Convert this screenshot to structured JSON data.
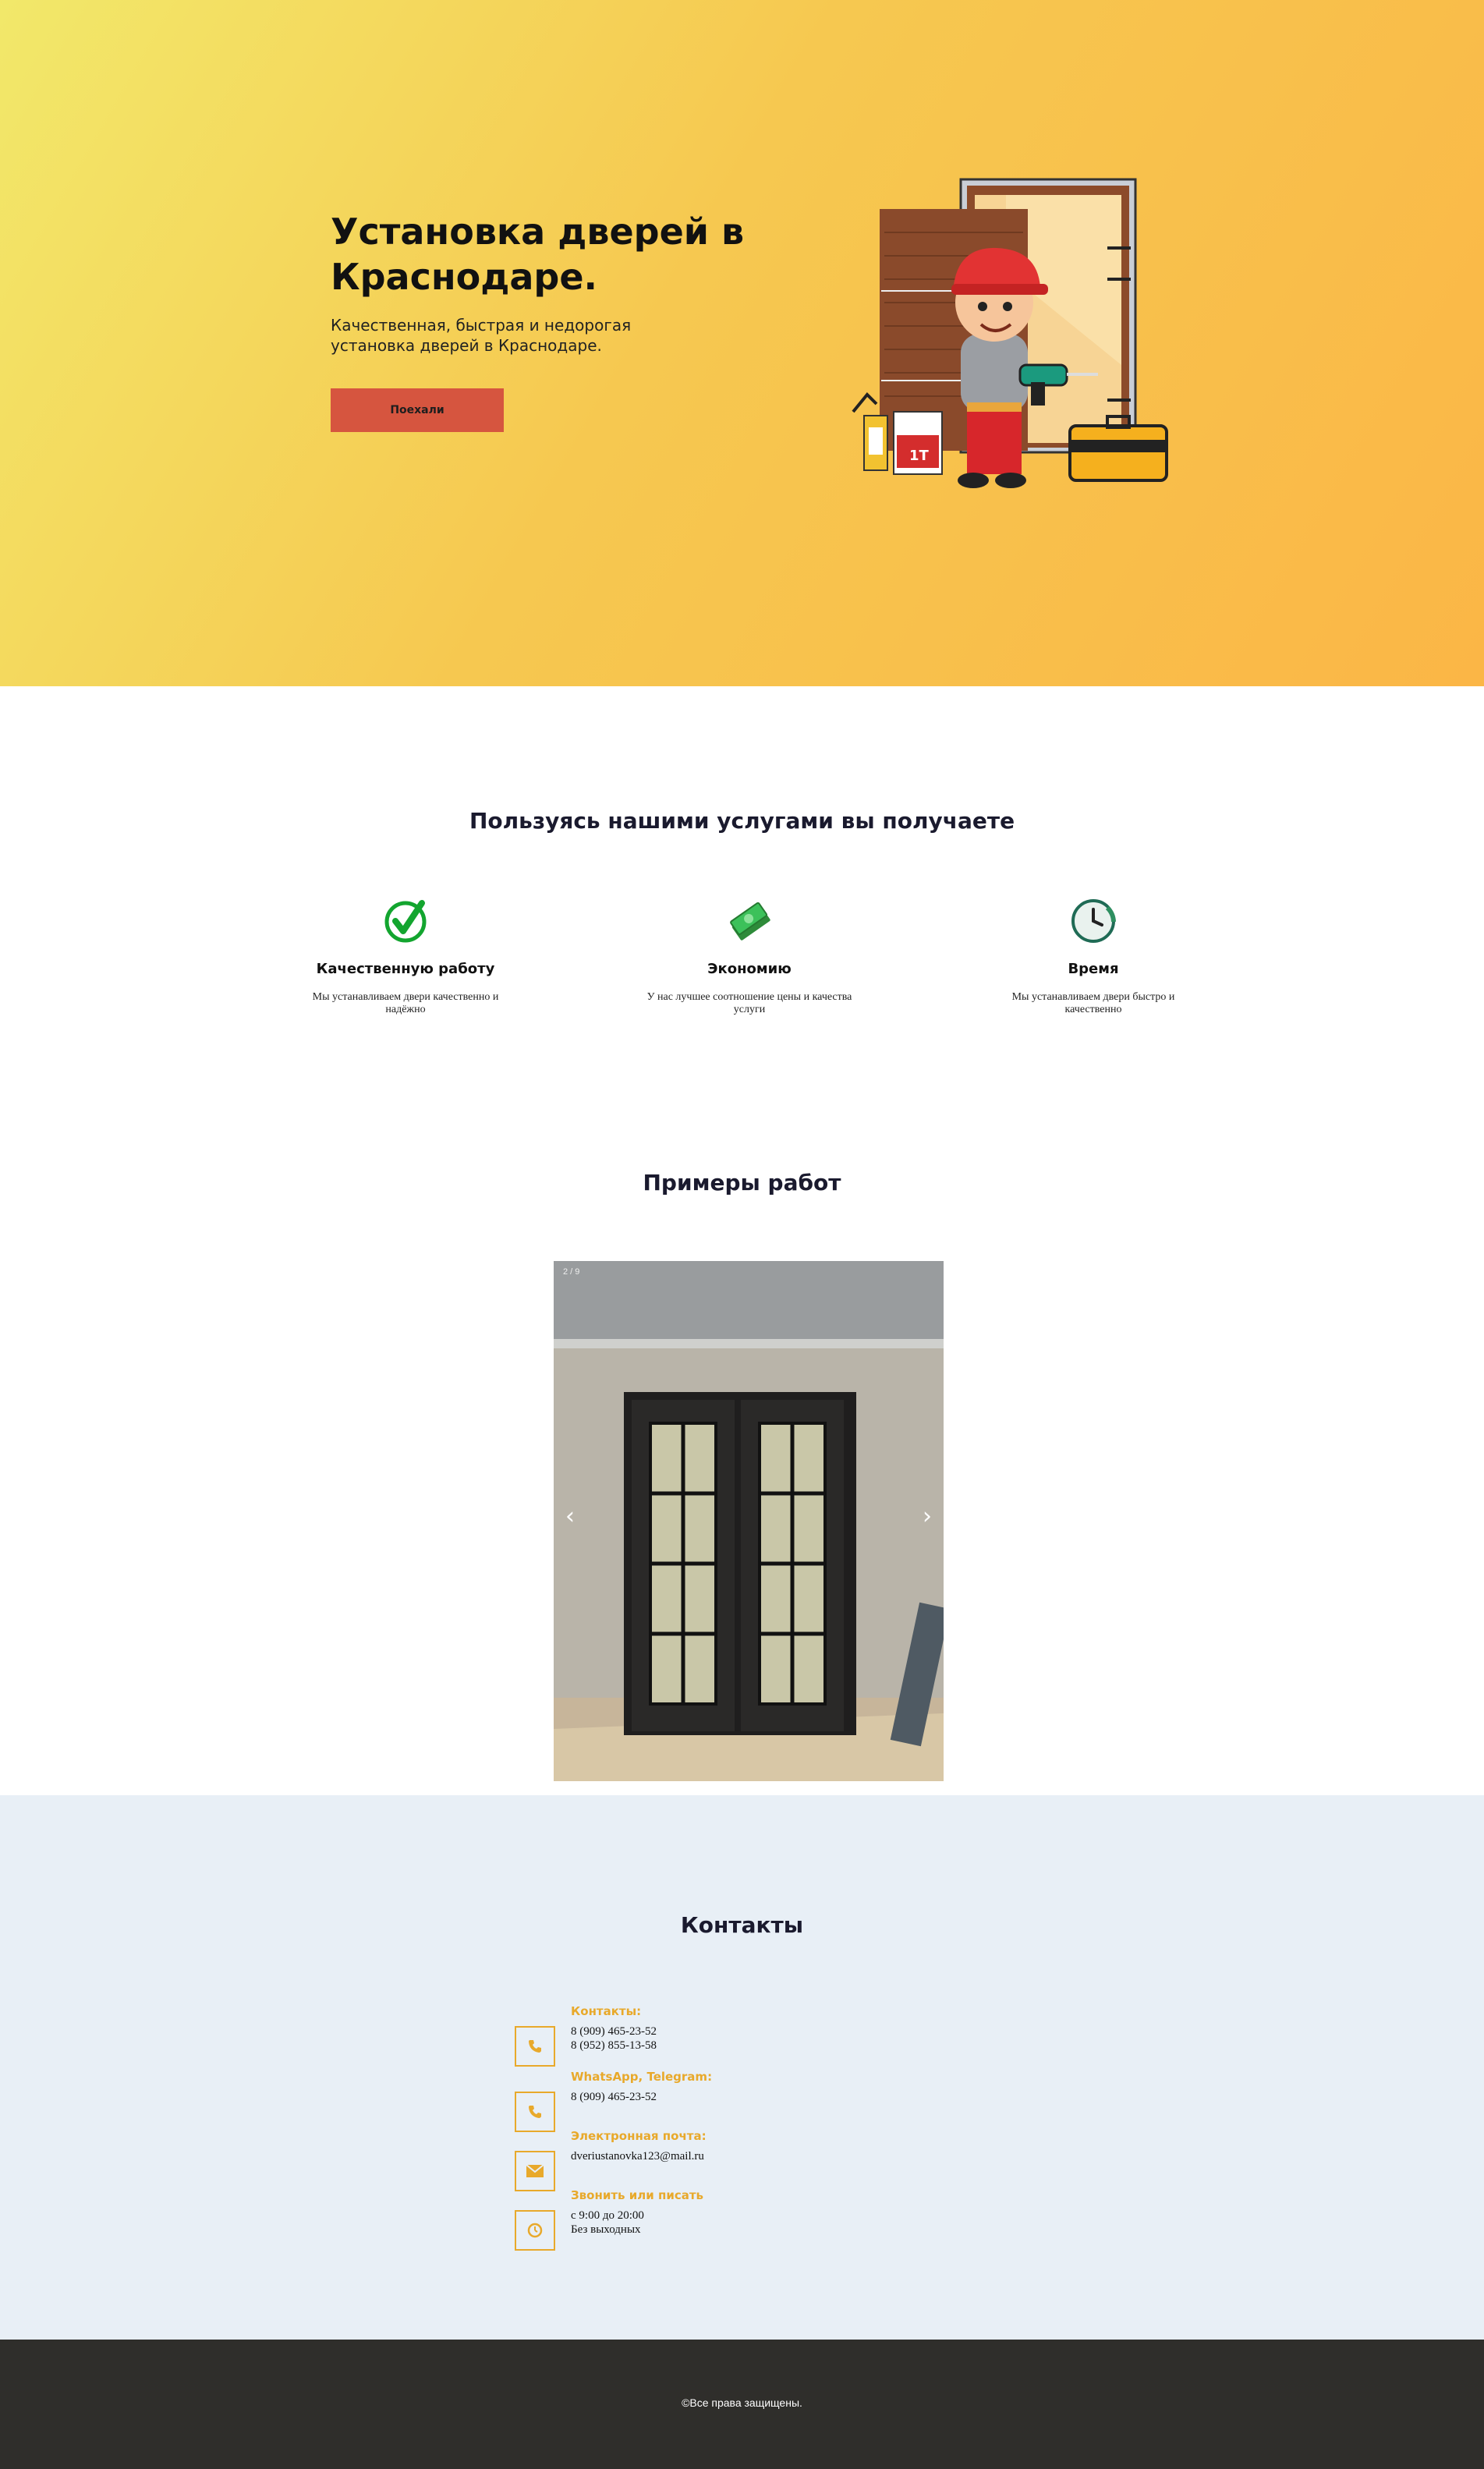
{
  "hero": {
    "title": "Установка дверей в Краснодаре.",
    "subtitle": "Качественная, быстрая и недорогая установка дверей в Краснодаре.",
    "button_label": "Поехали",
    "illustration_icon": "door-installer-illustration"
  },
  "benefits": {
    "title": "Пользуясь нашими услугами вы получаете",
    "items": [
      {
        "icon": "checkmark-icon",
        "title": "Качественную работу",
        "text": "Мы устанавливаем двери качественно и надёжно"
      },
      {
        "icon": "money-icon",
        "title": "Экономию",
        "text": "У нас лучшее соотношение цены и качества услуги"
      },
      {
        "icon": "clock-icon",
        "title": "Время",
        "text": "Мы устанавливаем двери быстро и качественно"
      }
    ]
  },
  "works": {
    "title": "Примеры работ",
    "counter": "2 / 9",
    "prev_label": "‹",
    "next_label": "›"
  },
  "contacts": {
    "title": "Контакты",
    "items": [
      {
        "icon": "phone-icon",
        "label": "Контакты:",
        "lines": [
          "8 (909) 465-23-52",
          "8 (952) 855-13-58"
        ]
      },
      {
        "icon": "phone-icon",
        "label": "WhatsApp, Telegram:",
        "lines": [
          "8 (909) 465-23-52"
        ]
      },
      {
        "icon": "envelope-icon",
        "label": "Электронная почта:",
        "lines": [
          "dveriustanovka123@mail.ru"
        ]
      },
      {
        "icon": "clock-icon",
        "label": "Звонить или писать",
        "lines": [
          "с 9:00 до 20:00",
          "Без выходных"
        ]
      }
    ],
    "accent_color": "#e8a92b"
  },
  "footer": {
    "text": "©Все права защищены."
  },
  "colors": {
    "hero_gradient_start": "#f2e86a",
    "hero_gradient_end": "#fbb646",
    "button": "#d6553f",
    "contacts_bg": "#e8eff6",
    "footer_bg": "#2f2e2b"
  }
}
